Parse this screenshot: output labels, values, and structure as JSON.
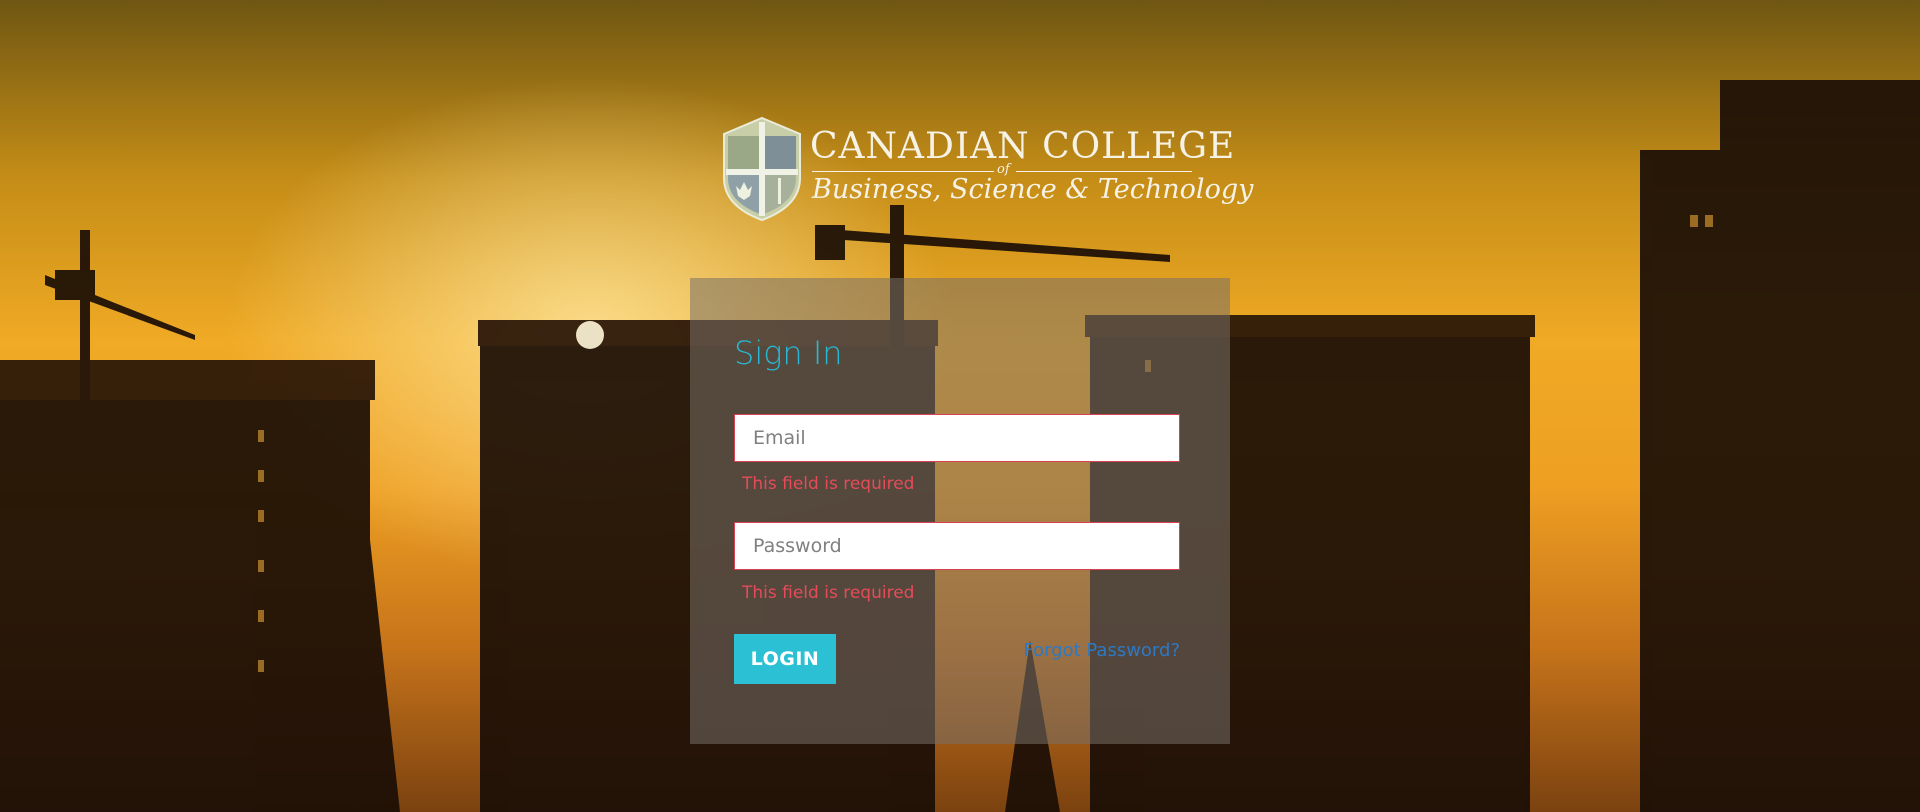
{
  "brand": {
    "line1": "CANADIAN COLLEGE",
    "of": "of",
    "line2": "Business, Science & Technology"
  },
  "form": {
    "title": "Sign In",
    "email": {
      "placeholder": "Email",
      "value": "",
      "error": "This field is required"
    },
    "password": {
      "placeholder": "Password",
      "value": "",
      "error": "This field is required"
    },
    "login_label": "LOGIN",
    "forgot_label": "Forgot Password?"
  },
  "colors": {
    "accent": "#2bc0d4",
    "title": "#29b8d4",
    "error": "#e64b5a",
    "link": "#2d79c4"
  }
}
